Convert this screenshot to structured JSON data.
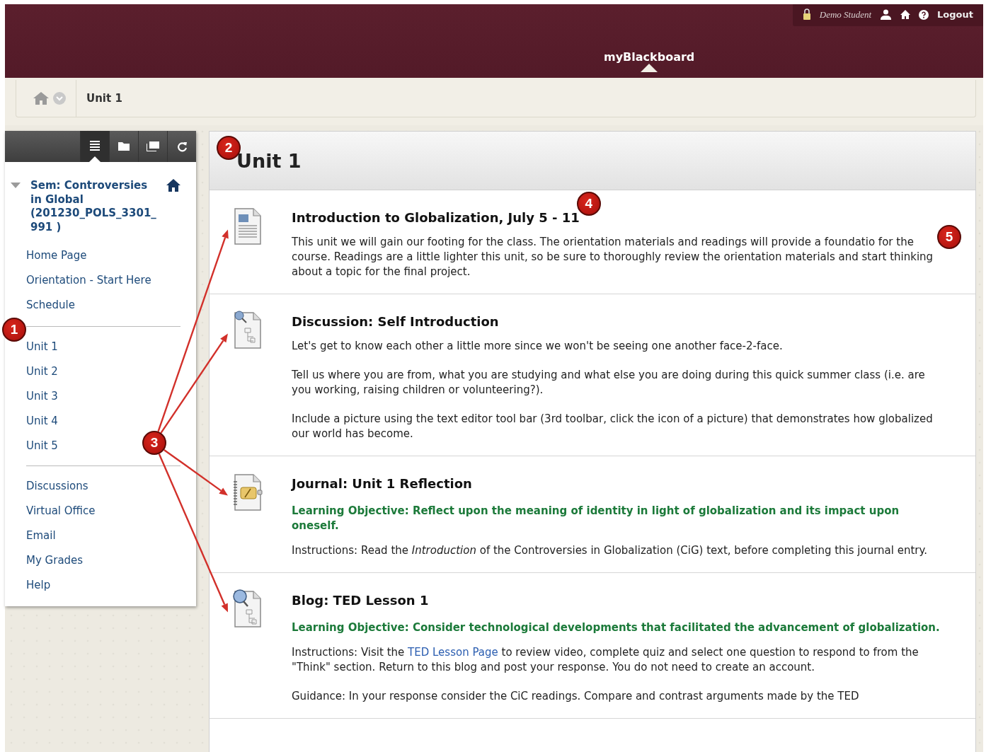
{
  "header": {
    "user_name": "Demo Student",
    "logout": "Logout",
    "tabs": [
      {
        "label": "myBlackboard",
        "selected": true
      }
    ]
  },
  "breadcrumb": {
    "current": "Unit 1"
  },
  "sidebar": {
    "toolbar": [
      {
        "kind": "list",
        "selected": true
      },
      {
        "kind": "folder",
        "selected": false
      },
      {
        "kind": "windows",
        "selected": false
      },
      {
        "kind": "refresh",
        "selected": false
      }
    ],
    "course": {
      "title": "Sem: Controversies in Global (201230_POLS_3301_991 )",
      "expanded": true
    },
    "groups": [
      [
        {
          "label": "Home Page"
        },
        {
          "label": "Orientation - Start Here"
        },
        {
          "label": "Schedule"
        }
      ],
      [
        {
          "label": "Unit 1",
          "callout": "1"
        },
        {
          "label": "Unit 2"
        },
        {
          "label": "Unit 3"
        },
        {
          "label": "Unit 4"
        },
        {
          "label": "Unit 5"
        }
      ],
      [
        {
          "label": "Discussions"
        },
        {
          "label": "Virtual Office"
        },
        {
          "label": "Email"
        },
        {
          "label": "My Grades"
        },
        {
          "label": "Help"
        }
      ]
    ],
    "arrow_callout": "3"
  },
  "page": {
    "title": "Unit 1",
    "title_callout": "2",
    "items": [
      {
        "kind": "document",
        "title": "Introduction to Globalization, July 5 - 11",
        "title_callout": "4",
        "text_callout": "5",
        "paragraphs": [
          [
            {
              "kind": "text",
              "text": "This unit we will gain our footing for the class.  The orientation materials and readings will provide a foundatio"
            },
            {
              "kind": "text",
              "text": " for the course.  Readings are a little lighter this unit, so be sure to thoroughly review the orientation materials and start thinking about a topic for the final project."
            }
          ]
        ]
      },
      {
        "kind": "discussion",
        "title": "Discussion: Self Introduction",
        "paragraphs": [
          [
            {
              "kind": "text",
              "text": "Let's get to know each other a little more since we won't be seeing one another face-2-face."
            }
          ],
          [
            {
              "kind": "text",
              "text": "Tell us where you are from, what you are studying and what else you are doing during this quick summer class (i.e. are you working, raising children or volunteering?)."
            }
          ],
          [
            {
              "kind": "text",
              "text": "Include a picture using the text editor tool bar (3rd toolbar, click the icon of a picture) that demonstrates how globalized our world has become."
            }
          ]
        ]
      },
      {
        "kind": "journal",
        "title": "Journal: Unit 1 Reflection",
        "objective": "Learning Objective: Reflect upon the meaning of identity in light of globalization and its impact upon oneself.",
        "paragraphs": [
          [
            {
              "kind": "text",
              "text": "Instructions: Read the *Introduction* of the Controversies in Globalization (CiG) text, before completing this journal entry."
            }
          ]
        ]
      },
      {
        "kind": "blog",
        "title": "Blog: TED Lesson 1",
        "objective": "Learning Objective: Consider technological developments that facilitated the advancement of globalization.",
        "paragraphs": [
          [
            {
              "kind": "text",
              "text": "Instructions: Visit the "
            },
            {
              "kind": "link",
              "text": "TED Lesson Page"
            },
            {
              "kind": "text",
              "text": " to review video, complete quiz and select one question to respond to from the \"Think\" section. Return to this blog and post your response.  You do not need to create an account."
            }
          ],
          [
            {
              "kind": "text",
              "text": "Guidance: In your response consider the CiC readings. Compare and contrast arguments made by the TED"
            }
          ]
        ]
      }
    ]
  }
}
